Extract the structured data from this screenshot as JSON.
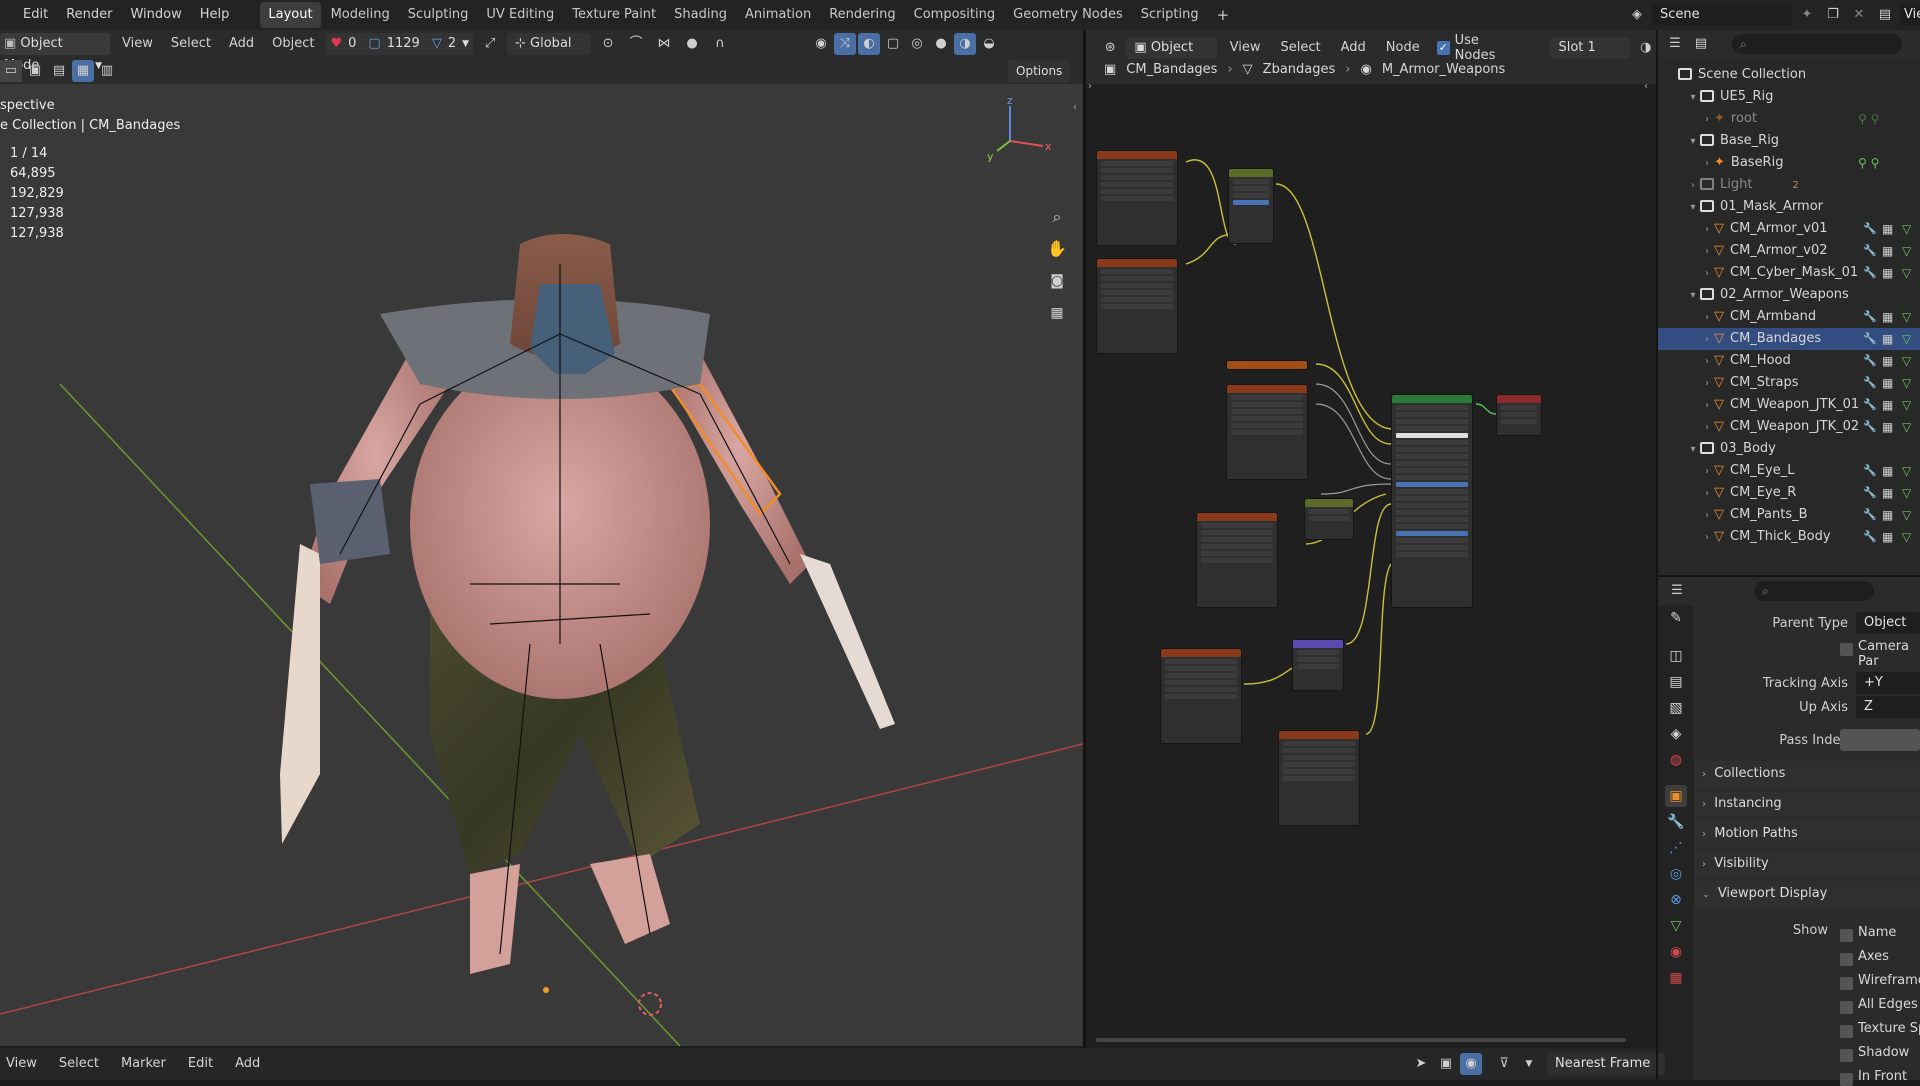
{
  "topbar": {
    "menus": [
      "Edit",
      "Render",
      "Window",
      "Help"
    ],
    "workspaces": [
      "Layout",
      "Modeling",
      "Sculpting",
      "UV Editing",
      "Texture Paint",
      "Shading",
      "Animation",
      "Rendering",
      "Compositing",
      "Geometry Nodes",
      "Scripting"
    ],
    "active_workspace": "Layout",
    "plus": "+",
    "scene_name": "Scene",
    "view_layer": "ViewL"
  },
  "viewport": {
    "mode": "Object Mode",
    "menus": [
      "View",
      "Select",
      "Add",
      "Object"
    ],
    "stat_a": "0",
    "stat_b": "1129",
    "stat_c": "2",
    "orientation": "Global",
    "options": "Options",
    "overlay_line1": "spective",
    "overlay_line2": "e Collection | CM_Bandages",
    "stats": [
      "1 / 14",
      "64,895",
      "192,829",
      "127,938",
      "127,938"
    ],
    "axis_x": "x",
    "axis_y": "y",
    "axis_z": "z"
  },
  "node_editor": {
    "type": "Object",
    "menus": [
      "View",
      "Select",
      "Add",
      "Node"
    ],
    "use_nodes": "Use Nodes",
    "slot": "Slot 1",
    "breadcrumb": [
      "CM_Bandages",
      "Zbandages",
      "M_Armor_Weapons"
    ]
  },
  "outliner": {
    "root": "Scene Collection",
    "rows": [
      {
        "label": "UE5_Rig",
        "kind": "collection",
        "level": 1,
        "open": true
      },
      {
        "label": "root",
        "kind": "armature",
        "level": 2,
        "dim": true
      },
      {
        "label": "Base_Rig",
        "kind": "collection",
        "level": 1,
        "open": true
      },
      {
        "label": "BaseRig",
        "kind": "armature",
        "level": 2
      },
      {
        "label": "Light",
        "kind": "collection",
        "level": 1,
        "dim": true,
        "badge": "2"
      },
      {
        "label": "01_Mask_Armor",
        "kind": "collection",
        "level": 1,
        "open": true
      },
      {
        "label": "CM_Armor_v01",
        "kind": "mesh",
        "level": 2
      },
      {
        "label": "CM_Armor_v02",
        "kind": "mesh",
        "level": 2
      },
      {
        "label": "CM_Cyber_Mask_01",
        "kind": "mesh",
        "level": 2
      },
      {
        "label": "02_Armor_Weapons",
        "kind": "collection",
        "level": 1,
        "open": true
      },
      {
        "label": "CM_Armband",
        "kind": "mesh",
        "level": 2
      },
      {
        "label": "CM_Bandages",
        "kind": "mesh",
        "level": 2,
        "selected": true
      },
      {
        "label": "CM_Hood",
        "kind": "mesh",
        "level": 2
      },
      {
        "label": "CM_Straps",
        "kind": "mesh",
        "level": 2
      },
      {
        "label": "CM_Weapon_JTK_01",
        "kind": "mesh",
        "level": 2
      },
      {
        "label": "CM_Weapon_JTK_02",
        "kind": "mesh",
        "level": 2
      },
      {
        "label": "03_Body",
        "kind": "collection",
        "level": 1,
        "open": true
      },
      {
        "label": "CM_Eye_L",
        "kind": "mesh",
        "level": 2
      },
      {
        "label": "CM_Eye_R",
        "kind": "mesh",
        "level": 2
      },
      {
        "label": "CM_Pants_B",
        "kind": "mesh",
        "level": 2
      },
      {
        "label": "CM_Thick_Body",
        "kind": "mesh",
        "level": 2
      }
    ]
  },
  "properties": {
    "parent_type_label": "Parent Type",
    "parent_type_value": "Object",
    "camera_par": "Camera Par",
    "tracking_axis_label": "Tracking Axis",
    "tracking_axis_value": "+Y",
    "up_axis_label": "Up Axis",
    "up_axis_value": "Z",
    "pass_index_label": "Pass Index",
    "panels": [
      "Collections",
      "Instancing",
      "Motion Paths",
      "Visibility"
    ],
    "open_panel": "Viewport Display",
    "show_label": "Show",
    "show_items": [
      "Name",
      "Axes",
      "Wireframe",
      "All Edges",
      "Texture Spa",
      "Shadow",
      "In Front"
    ]
  },
  "timeline": {
    "menus": [
      "View",
      "Select",
      "Marker",
      "Edit",
      "Add"
    ],
    "keying": "Nearest Frame"
  },
  "colors": {
    "accent_selected": "#334d80",
    "mesh_orange": "#f08c2b",
    "node_wire": "#c9c13a"
  }
}
